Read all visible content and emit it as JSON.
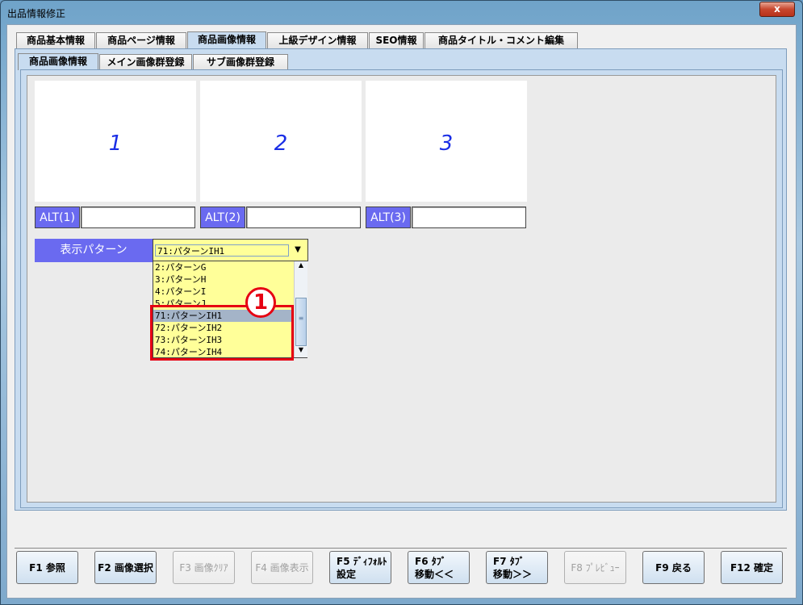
{
  "window": {
    "title": "出品情報修正",
    "close_label": "x"
  },
  "tabs": [
    "商品基本情報",
    "商品ページ情報",
    "商品画像情報",
    "上級デザイン情報",
    "SEO情報",
    "商品タイトル・コメント編集"
  ],
  "subtabs": [
    "商品画像情報",
    "メイン画像群登録",
    "サブ画像群登録"
  ],
  "images": [
    {
      "num": "1",
      "alt": "ALT(1)",
      "value": ""
    },
    {
      "num": "2",
      "alt": "ALT(2)",
      "value": ""
    },
    {
      "num": "3",
      "alt": "ALT(3)",
      "value": ""
    }
  ],
  "pattern": {
    "label": "表示パターン",
    "selected": "71:パターンIH1",
    "options": [
      "2:パターンG",
      "3:パターンH",
      "4:パターンI",
      "5:パターンJ",
      "71:パターンIH1",
      "72:パターンIH2",
      "73:パターンIH3",
      "74:パターンIH4"
    ],
    "annotation": "①"
  },
  "buttons": [
    {
      "l1": "F1 参照",
      "l2": "",
      "enabled": true
    },
    {
      "l1": "F2 画像選択",
      "l2": "",
      "enabled": true
    },
    {
      "l1": "F3 画像ｸﾘｱ",
      "l2": "",
      "enabled": false
    },
    {
      "l1": "F4 画像表示",
      "l2": "",
      "enabled": false
    },
    {
      "l1": "F5 ﾃﾞｨﾌｫﾙﾄ",
      "l2": "設定",
      "enabled": true
    },
    {
      "l1": "F6 ﾀﾌﾞ",
      "l2": "移動＜＜",
      "enabled": true
    },
    {
      "l1": "F7 ﾀﾌﾞ",
      "l2": "移動＞＞",
      "enabled": true
    },
    {
      "l1": "F8 ﾌﾟﾚﾋﾞｭｰ",
      "l2": "",
      "enabled": false
    },
    {
      "l1": "F9 戻る",
      "l2": "",
      "enabled": true
    },
    {
      "l1": "F12 確定",
      "l2": "",
      "enabled": true
    }
  ]
}
